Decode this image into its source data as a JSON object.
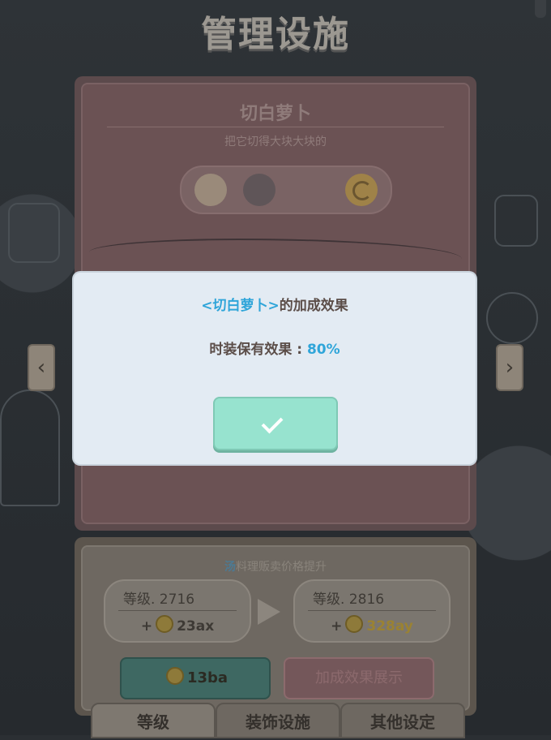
{
  "screen": {
    "title": "管理设施"
  },
  "facility": {
    "name": "切白萝卜",
    "description": "把它切得大块大块的"
  },
  "upgrade": {
    "boost_keyword": "汤",
    "boost_text": "料理贩卖价格提升",
    "current_level": "等级. 2716",
    "current_cost_prefix": "+",
    "current_cost": "23ax",
    "next_level": "等级. 2816",
    "next_cost_prefix": "+",
    "next_cost": "328ay",
    "upgrade_cost": "13ba",
    "show_bonus_label": "加成效果展示"
  },
  "tabs": [
    "等级",
    "装饰设施",
    "其他设定"
  ],
  "dialog": {
    "title_highlight": "<切白萝卜>",
    "title_rest": "的加成效果",
    "body_label": "时装保有效果 : ",
    "body_value": "80%"
  },
  "colors": {
    "accent": "#2fa5d9",
    "confirm": "#97e3cf"
  },
  "icons": [
    "cat-icon",
    "grape-icon",
    "refresh-icon",
    "left-arrow-icon",
    "right-arrow-icon",
    "coin-icon",
    "check-icon"
  ]
}
